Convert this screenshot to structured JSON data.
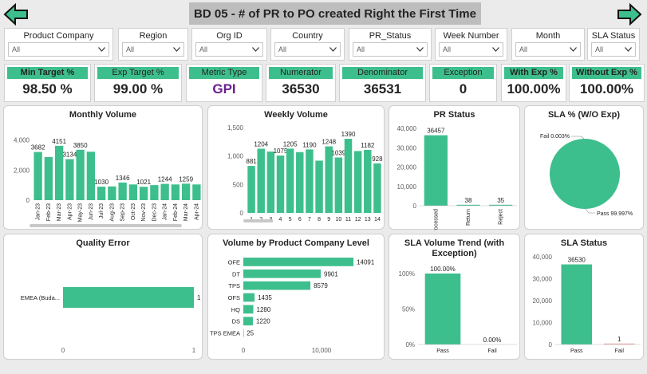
{
  "header": {
    "title": "BD 05 - # of PR to PO created Right the First Time",
    "back_icon": "arrow-left-icon",
    "forward_icon": "arrow-right-icon"
  },
  "filters": [
    {
      "label": "Product Company",
      "value": "All"
    },
    {
      "label": "Region",
      "value": "All"
    },
    {
      "label": "Org ID",
      "value": "All"
    },
    {
      "label": "Country",
      "value": "All"
    },
    {
      "label": "PR_Status",
      "value": "All"
    },
    {
      "label": "Week Number",
      "value": "All"
    },
    {
      "label": "Month",
      "value": "All"
    },
    {
      "label": "SLA Status",
      "value": "All"
    }
  ],
  "kpis": [
    {
      "label": "Min Target %",
      "value": "98.50 %"
    },
    {
      "label": "Exp Target %",
      "value": "99.00 %"
    },
    {
      "label": "Metric Type",
      "value": "GPI"
    },
    {
      "label": "Numerator",
      "value": "36530"
    },
    {
      "label": "Denominator",
      "value": "36531"
    },
    {
      "label": "Exception",
      "value": "0"
    },
    {
      "label": "With Exp %",
      "value": "100.00%"
    },
    {
      "label": "Without Exp %",
      "value": "100.00%"
    }
  ],
  "colors": {
    "accent": "#3dbf8d",
    "metric_type": "#6b1f8f",
    "fail_bar": "#e8a0a0"
  },
  "chart_data": [
    {
      "id": "monthly",
      "type": "bar",
      "title": "Monthly Volume",
      "categories": [
        "Jan-23",
        "Feb-23",
        "Mar-23",
        "Apr-23",
        "May-23",
        "Jun-23",
        "Jul-23",
        "Aug-23",
        "Sep-23",
        "Oct-23",
        "Nov-23",
        "Dec-23",
        "Jan-24",
        "Feb-24",
        "Mar-24",
        "Apr-24"
      ],
      "values": [
        3682,
        3300,
        4151,
        3134,
        3850,
        3700,
        1030,
        1050,
        1346,
        1200,
        1021,
        1150,
        1244,
        1200,
        1259,
        1200
      ],
      "data_labels": [
        "3682",
        "",
        "4151",
        "3134",
        "3850",
        "",
        "1030",
        "",
        "1346",
        "",
        "1021",
        "",
        "1244",
        "",
        "1259",
        ""
      ],
      "yticks": [
        "0",
        "2,000",
        "4,000"
      ],
      "ylim": [
        0,
        4600
      ],
      "scrollbar": true
    },
    {
      "id": "weekly",
      "type": "bar",
      "title": "Weekly Volume",
      "categories": [
        "1",
        "2",
        "3",
        "4",
        "5",
        "6",
        "7",
        "8",
        "9",
        "10",
        "11",
        "12",
        "13",
        "14"
      ],
      "values": [
        881,
        1204,
        1150,
        1075,
        1205,
        1140,
        1190,
        980,
        1248,
        1039,
        1390,
        1160,
        1182,
        928
      ],
      "data_labels": [
        "881",
        "1204",
        "",
        "1075",
        "1205",
        "",
        "1190",
        "",
        "1248",
        "1039",
        "1390",
        "",
        "1182",
        "928"
      ],
      "yticks": [
        "0",
        "500",
        "1,000",
        "1,500"
      ],
      "ylim": [
        0,
        1600
      ],
      "scrollbar": true
    },
    {
      "id": "pr_status",
      "type": "bar",
      "title": "PR Status",
      "categories": [
        "Processed",
        "Return",
        "Reject"
      ],
      "values": [
        36457,
        38,
        35
      ],
      "data_labels": [
        "36457",
        "38",
        "35"
      ],
      "yticks": [
        "0",
        "10,000",
        "20,000",
        "30,000",
        "40,000"
      ],
      "ylim": [
        0,
        40000
      ]
    },
    {
      "id": "sla_pie",
      "type": "pie",
      "title": "SLA % (W/O Exp)",
      "slices": [
        {
          "label": "Pass",
          "value": 99.997,
          "text": "Pass 99.997%"
        },
        {
          "label": "Fail",
          "value": 0.003,
          "text": "Fail 0.003%"
        }
      ]
    },
    {
      "id": "quality",
      "type": "bar",
      "title": "Quality Error",
      "orientation": "horizontal",
      "categories": [
        "EMEA (Buda..."
      ],
      "values": [
        1
      ],
      "data_labels": [
        "1"
      ],
      "xticks": [
        "0",
        "1"
      ],
      "xlim": [
        0,
        1
      ]
    },
    {
      "id": "product_level",
      "type": "bar",
      "title": "Volume by Product Company Level",
      "orientation": "horizontal",
      "categories": [
        "OFE",
        "DT",
        "TPS",
        "OFS",
        "HQ",
        "DS",
        "TPS EMEA"
      ],
      "values": [
        14091,
        9901,
        8579,
        1435,
        1280,
        1220,
        25
      ],
      "data_labels": [
        "14091",
        "9901",
        "8579",
        "1435",
        "1280",
        "1220",
        "25"
      ],
      "xticks": [
        "0",
        "10,000"
      ],
      "xlim": [
        0,
        15000
      ]
    },
    {
      "id": "sla_trend",
      "type": "bar",
      "title": "SLA Volume Trend (with Exception)",
      "categories": [
        "Pass",
        "Fail"
      ],
      "values": [
        100.0,
        0.0
      ],
      "data_labels": [
        "100.00%",
        "0.00%"
      ],
      "yticks": [
        "0%",
        "50%",
        "100%"
      ],
      "ylim": [
        0,
        100
      ]
    },
    {
      "id": "sla_status",
      "type": "bar",
      "title": "SLA Status",
      "categories": [
        "Pass",
        "Fail"
      ],
      "values": [
        36530,
        1
      ],
      "data_labels": [
        "36530",
        "1"
      ],
      "yticks": [
        "0",
        "10,000",
        "20,000",
        "30,000",
        "40,000"
      ],
      "ylim": [
        0,
        40000
      ]
    }
  ]
}
